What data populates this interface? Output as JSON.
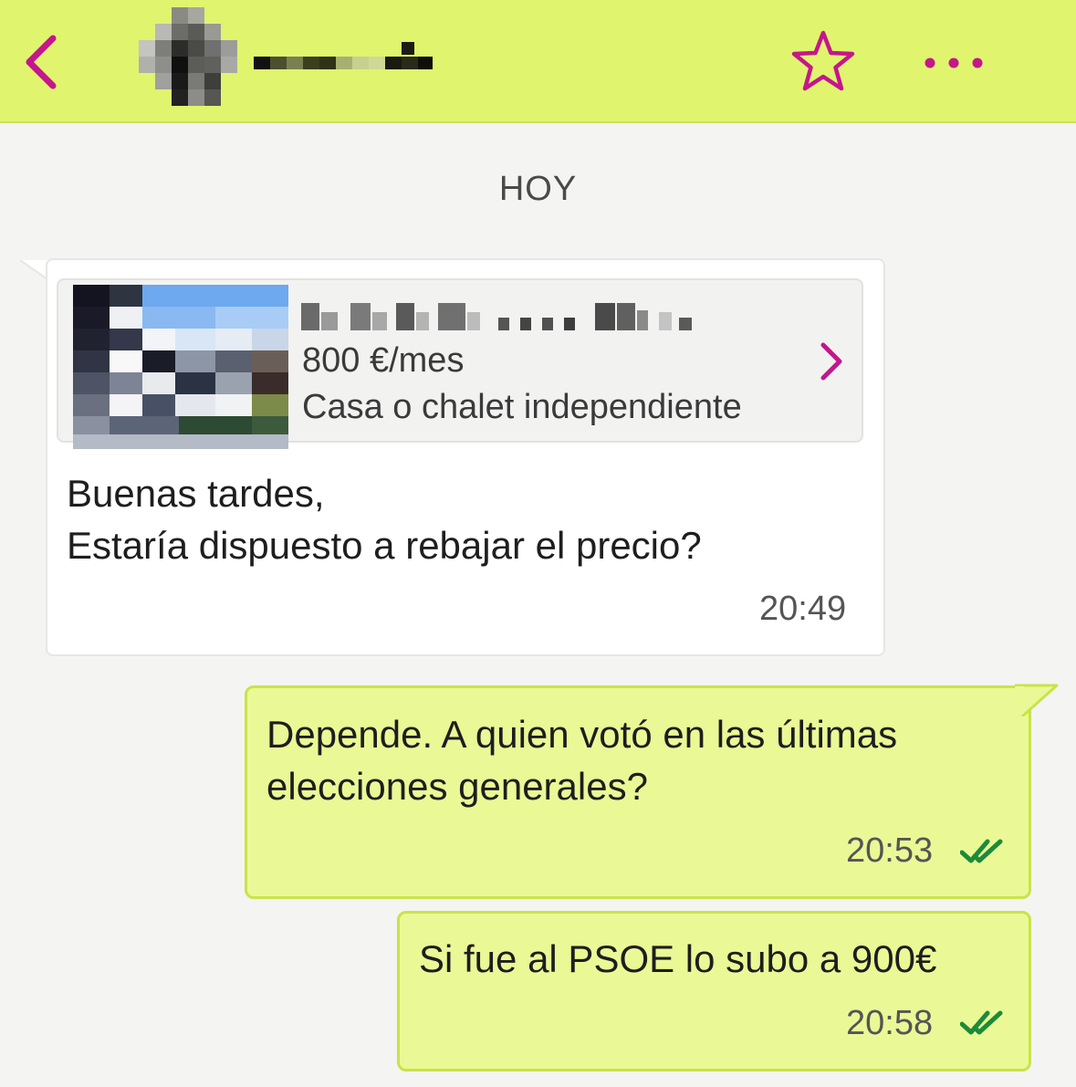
{
  "header": {
    "back_icon": "chevron-left-icon",
    "favorite_icon": "star-icon",
    "more_icon": "more-dots-icon",
    "accent_color": "#c5168c",
    "background_color": "#e0f46e"
  },
  "conversation": {
    "day_label": "HOY",
    "messages": [
      {
        "direction": "incoming",
        "listing": {
          "price": "800 €/mes",
          "type": "Casa o chalet independiente"
        },
        "lines": [
          "Buenas tardes,",
          "Estaría dispuesto a rebajar el precio?"
        ],
        "time": "20:49"
      },
      {
        "direction": "outgoing",
        "lines": [
          "Depende. A quien votó en las últimas",
          "elecciones generales?"
        ],
        "time": "20:53",
        "status_icon": "double-check-icon"
      },
      {
        "direction": "outgoing",
        "lines": [
          "Si fue al PSOE lo subo a 900€"
        ],
        "time": "20:58",
        "status_icon": "double-check-icon"
      }
    ]
  }
}
